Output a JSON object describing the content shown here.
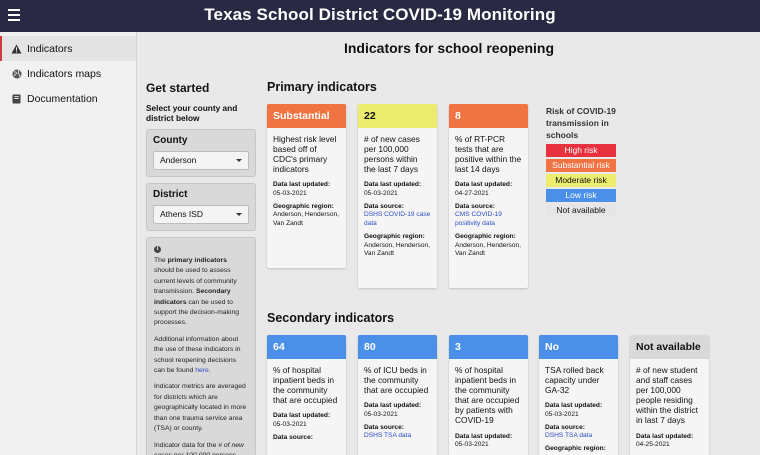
{
  "header": {
    "title": "Texas School District COVID-19 Monitoring"
  },
  "sidebar": {
    "items": [
      {
        "label": "Indicators",
        "icon": "warning-icon",
        "active": true
      },
      {
        "label": "Indicators maps",
        "icon": "globe-icon",
        "active": false
      },
      {
        "label": "Documentation",
        "icon": "book-icon",
        "active": false
      }
    ]
  },
  "main": {
    "title": "Indicators for school reopening",
    "get_started": {
      "heading": "Get started",
      "subtitle": "Select your county and district below",
      "county_label": "County",
      "county_value": "Anderson",
      "district_label": "District",
      "district_value": "Athens ISD"
    },
    "info": {
      "p1_a": "The ",
      "p1_b": "primary indicators",
      "p1_c": " should be used to assess current levels of community transmission. ",
      "p1_d": "Secondary indicators",
      "p1_e": " can be used to support the decision-making processes.",
      "p2_a": "Additional information about the use of these indicators in school reopening decisions can be found ",
      "p2_link": "here",
      "p2_end": ".",
      "p3": "Indicator metrics are averaged for districts which are geographically located in more than one trauma service area (TSA) or county.",
      "p4_a": "Indicator data for the ",
      "p4_b": "# of new cases per 100,000 persons"
    },
    "primary": {
      "title": "Primary indicators",
      "cards": [
        {
          "value": "Substantial",
          "color": "#f07342",
          "desc": "Highest risk level based off of CDC's primary indicators",
          "updated_label": "Data last updated:",
          "updated": "05-03-2021",
          "region_label": "Geographic region:",
          "region": "Anderson, Henderson, Van Zandt"
        },
        {
          "value": "22",
          "color": "#ecec6e",
          "desc": "# of new cases per 100,000 persons within the last 7 days",
          "updated_label": "Data last updated:",
          "updated": "05-03-2021",
          "source_label": "Data source:",
          "source": "DSHS COVID-19 case data",
          "region_label": "Geographic region:",
          "region": "Anderson, Henderson, Van Zandt"
        },
        {
          "value": "8",
          "color": "#f07342",
          "desc": "% of RT-PCR tests that are positive within the last 14 days",
          "updated_label": "Data last updated:",
          "updated": "04-27-2021",
          "source_label": "Data source:",
          "source": "CMS COVID-19 positivity data",
          "region_label": "Geographic region:",
          "region": "Anderson, Henderson, Van Zandt"
        }
      ]
    },
    "legend": {
      "title": "Risk of COVID-19 transmission in schools",
      "items": [
        {
          "label": "High risk",
          "color": "#e8313f",
          "text": "#ffffff"
        },
        {
          "label": "Substantial risk",
          "color": "#f07342",
          "text": "#ffffff"
        },
        {
          "label": "Moderate risk",
          "color": "#ecec6e",
          "text": "#111111"
        },
        {
          "label": "Low risk",
          "color": "#4a8fe8",
          "text": "#ffffff"
        },
        {
          "label": "Not available",
          "color": "#e6e6e6",
          "text": "#111111"
        }
      ]
    },
    "secondary": {
      "title": "Secondary indicators",
      "cards": [
        {
          "value": "64",
          "color": "#4a8fe8",
          "desc": "% of hospital inpatient beds in the community that are occupied",
          "updated_label": "Data last updated:",
          "updated": "05-03-2021",
          "source_label": "Data source:"
        },
        {
          "value": "80",
          "color": "#4a8fe8",
          "desc": "% of ICU beds in the community that are occupied",
          "updated_label": "Data last updated:",
          "updated": "05-03-2021",
          "source_label": "Data source:",
          "source": "DSHS TSA data"
        },
        {
          "value": "3",
          "color": "#4a8fe8",
          "desc": "% of hospital inpatient beds in the community that are occupied by patients with COVID-19",
          "updated_label": "Data last updated:",
          "updated": "05-03-2021"
        },
        {
          "value": "No",
          "color": "#4a8fe8",
          "desc": "TSA rolled back capacity under GA-32",
          "updated_label": "Data last updated:",
          "updated": "05-03-2021",
          "source_label": "Data source:",
          "source": "DSHS TSA data",
          "region_label": "Geographic region:"
        },
        {
          "value": "Not available",
          "color": "#d9d9d9",
          "desc": "# of new student and staff cases per 100,000 people residing within the district in last 7 days",
          "updated_label": "Data last updated:",
          "updated": "04-25-2021"
        }
      ]
    }
  }
}
